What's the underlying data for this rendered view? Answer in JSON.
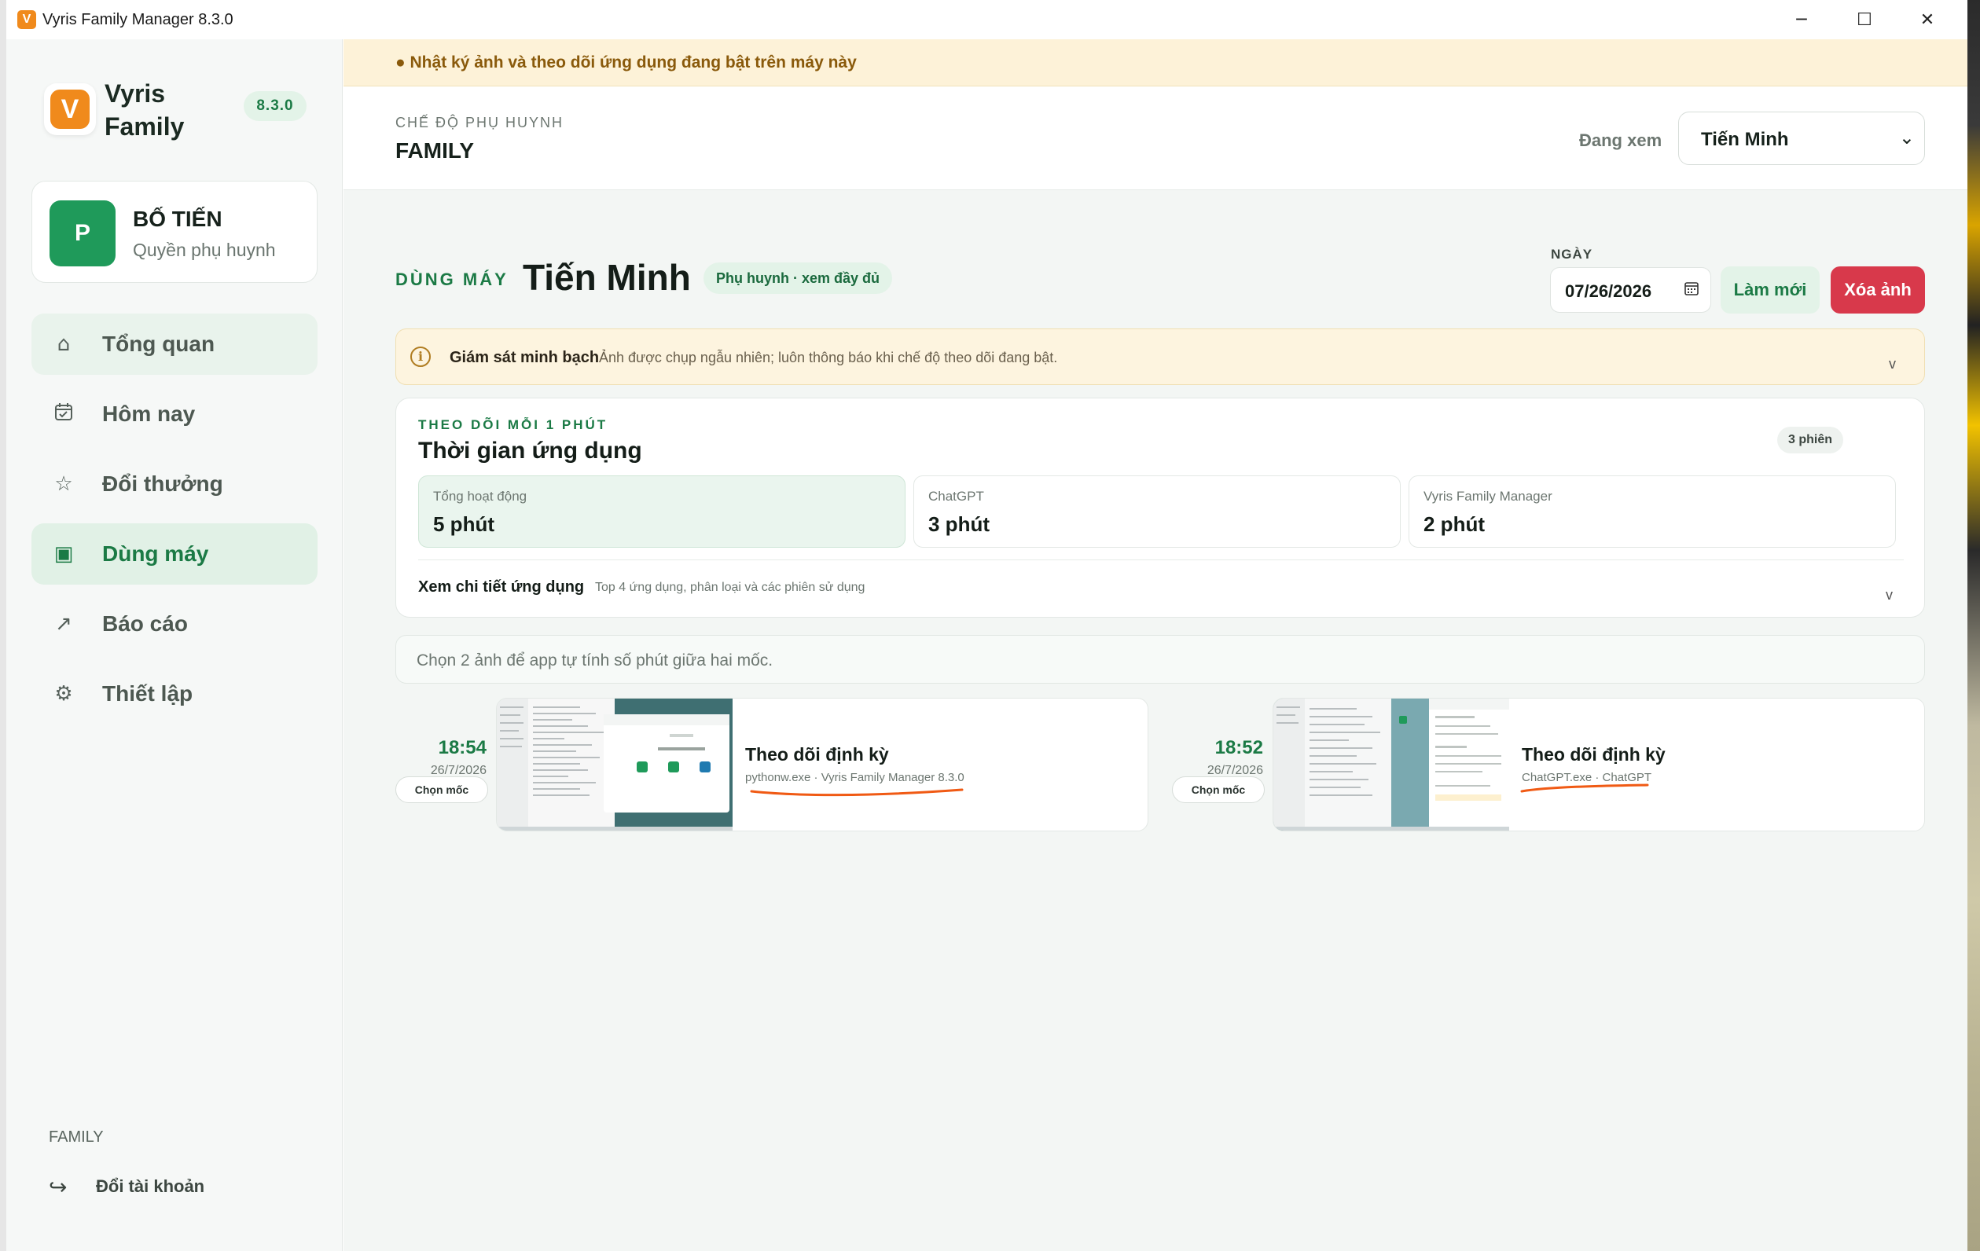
{
  "window": {
    "title": "Vyris Family Manager 8.3.0",
    "app_icon_letter": "V",
    "controls": {
      "minimize": "─",
      "maximize": "☐",
      "close": "✕"
    }
  },
  "sidebar": {
    "brand": {
      "logo_letter": "V",
      "name_line1": "Vyris",
      "name_line2": "Family",
      "version": "8.3.0"
    },
    "user": {
      "avatar_letter": "P",
      "name": "BỐ TIẾN",
      "role": "Quyền phụ huynh"
    },
    "nav": [
      {
        "label": "Tổng quan",
        "icon": "home-icon"
      },
      {
        "label": "Hôm nay",
        "icon": "calendar-icon"
      },
      {
        "label": "Đổi thưởng",
        "icon": "star-icon"
      },
      {
        "label": "Dùng máy",
        "icon": "device-icon"
      },
      {
        "label": "Báo cáo",
        "icon": "chart-arrow-icon"
      },
      {
        "label": "Thiết lập",
        "icon": "gear-icon"
      }
    ],
    "active_nav": "Dùng máy",
    "footer": {
      "family_label": "FAMILY",
      "switch_account": "Đổi tài khoản"
    }
  },
  "notice": {
    "text": "● Nhật ký ảnh và theo dõi ứng dụng đang bật trên máy này"
  },
  "header": {
    "eyebrow": "CHẾ ĐỘ PHỤ HUYNH",
    "title": "FAMILY",
    "viewing_label": "Đang xem",
    "viewing_value": "Tiến Minh"
  },
  "section": {
    "eyebrow": "DÙNG MÁY",
    "title": "Tiến Minh",
    "badge": "Phụ huynh · xem đầy đủ",
    "date_label": "NGÀY",
    "date_value": "07/26/2026",
    "refresh_button": "Làm mới",
    "delete_button": "Xóa ảnh"
  },
  "info": {
    "icon": "i",
    "title": "Giám sát minh bạch",
    "desc": "Ảnh được chụp ngẫu nhiên; luôn thông báo khi chế độ theo dõi đang bật.",
    "chevron": "v"
  },
  "usage": {
    "eyebrow": "THEO DÕI MỖI 1 PHÚT",
    "title": "Thời gian ứng dụng",
    "sessions": "3 phiên",
    "stats": [
      {
        "label": "Tổng hoạt động",
        "value": "5 phút"
      },
      {
        "label": "ChatGPT",
        "value": "3 phút"
      },
      {
        "label": "Vyris Family Manager",
        "value": "2 phút"
      }
    ],
    "detail_title": "Xem chi tiết ứng dụng",
    "detail_desc": "Top 4 ứng dụng, phân loại và các phiên sử dụng",
    "detail_chevron": "v"
  },
  "hint": {
    "text": "Chọn 2 ảnh để app tự tính số phút giữa hai mốc."
  },
  "screenshots": [
    {
      "time": "18:54",
      "date": "26/7/2026",
      "pick": "Chọn mốc",
      "label": "Theo dõi định kỳ",
      "app": "pythonw.exe · Vyris Family Manager 8.3.0"
    },
    {
      "time": "18:52",
      "date": "26/7/2026",
      "pick": "Chọn mốc",
      "label": "Theo dõi định kỳ",
      "app": "ChatGPT.exe · ChatGPT"
    }
  ],
  "colors": {
    "accent": "#1b7a45",
    "danger": "#d8394b",
    "brand": "#f08a1c",
    "annotation": "#f05a14"
  }
}
